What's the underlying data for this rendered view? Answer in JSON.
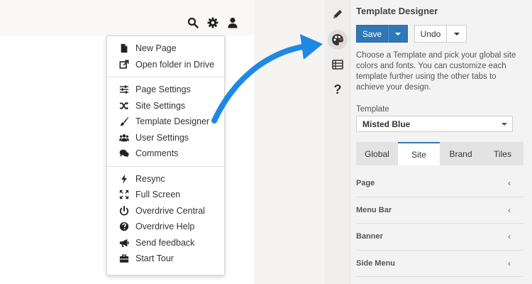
{
  "colors": {
    "accent": "#2f78b7",
    "arrow": "#1e88e5",
    "icon_dark": "#222222",
    "panel_bg": "#f3f3f3"
  },
  "top_icons": [
    "search-icon",
    "gear-icon",
    "user-icon"
  ],
  "menu": {
    "groups": [
      [
        {
          "label": "New Page",
          "icon": "file-icon"
        },
        {
          "label": "Open folder in Drive",
          "icon": "external-link-icon"
        }
      ],
      [
        {
          "label": "Page Settings",
          "icon": "sliders-icon"
        },
        {
          "label": "Site Settings",
          "icon": "shuffle-icon"
        },
        {
          "label": "Template Designer",
          "icon": "paint-brush-icon"
        },
        {
          "label": "User Settings",
          "icon": "users-icon"
        },
        {
          "label": "Comments",
          "icon": "comments-icon"
        }
      ],
      [
        {
          "label": "Resync",
          "icon": "bolt-icon"
        },
        {
          "label": "Full Screen",
          "icon": "expand-icon"
        },
        {
          "label": "Overdrive Central",
          "icon": "power-icon"
        },
        {
          "label": "Overdrive Help",
          "icon": "question-circle-icon"
        },
        {
          "label": "Send feedback",
          "icon": "bullhorn-icon"
        },
        {
          "label": "Start Tour",
          "icon": "briefcase-icon"
        }
      ]
    ]
  },
  "strip": [
    "pencil-icon",
    "palette-icon",
    "list-icon",
    "question-icon"
  ],
  "panel": {
    "title": "Template Designer",
    "save_label": "Save",
    "undo_label": "Undo",
    "description": "Choose a Template and pick your global site colors and fonts. You can customize each template further using the other tabs to achieve your design.",
    "template_label": "Template",
    "template_value": "Misted Blue",
    "tabs": [
      {
        "label": "Global",
        "active": false
      },
      {
        "label": "Site",
        "active": true
      },
      {
        "label": "Brand",
        "active": false
      },
      {
        "label": "Tiles",
        "active": false
      }
    ],
    "sections": [
      "Page",
      "Menu Bar",
      "Banner",
      "Side Menu"
    ],
    "chevron": "‹"
  }
}
